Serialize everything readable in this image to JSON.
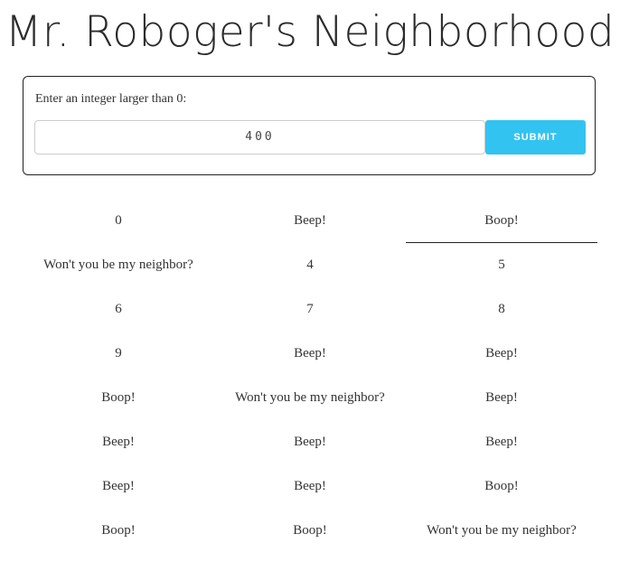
{
  "header": {
    "title": "Mr. Roboger's Neighborhood"
  },
  "form": {
    "prompt": "Enter an integer larger than 0:",
    "input_value": "400",
    "submit_label": "SUBMIT"
  },
  "colors": {
    "submit_background": "#33c3f0",
    "panel_border": "#222222",
    "text": "#333333"
  },
  "results": [
    "0",
    "Beep!",
    "Boop!",
    "Won't you be my neighbor?",
    "4",
    "5",
    "6",
    "7",
    "8",
    "9",
    "Beep!",
    "Beep!",
    "Boop!",
    "Won't you be my neighbor?",
    "Beep!",
    "Beep!",
    "Beep!",
    "Beep!",
    "Beep!",
    "Beep!",
    "Boop!",
    "Boop!",
    "Boop!",
    "Won't you be my neighbor?"
  ]
}
